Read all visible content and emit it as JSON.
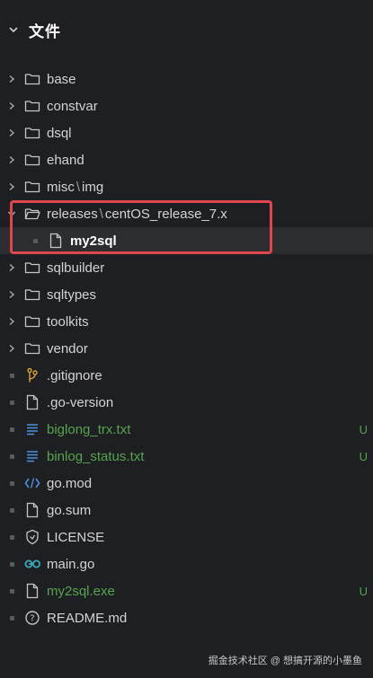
{
  "explorer": {
    "title": "文件",
    "items": [
      {
        "label": "base",
        "type": "folder"
      },
      {
        "label": "constvar",
        "type": "folder"
      },
      {
        "label": "dsql",
        "type": "folder"
      },
      {
        "label": "ehand",
        "type": "folder"
      },
      {
        "label_a": "misc",
        "label_b": "img",
        "type": "folder"
      },
      {
        "label_a": "releases",
        "label_b": "centOS_release_7.x",
        "type": "folder-open"
      },
      {
        "label": "my2sql",
        "type": "file-sub"
      },
      {
        "label": "sqlbuilder",
        "type": "folder"
      },
      {
        "label": "sqltypes",
        "type": "folder"
      },
      {
        "label": "toolkits",
        "type": "folder"
      },
      {
        "label": "vendor",
        "type": "folder"
      },
      {
        "label": ".gitignore",
        "type": "git"
      },
      {
        "label": ".go-version",
        "type": "file"
      },
      {
        "label": "biglong_trx.txt",
        "type": "text",
        "status": "U"
      },
      {
        "label": "binlog_status.txt",
        "type": "text",
        "status": "U"
      },
      {
        "label": "go.mod",
        "type": "gomod"
      },
      {
        "label": "go.sum",
        "type": "file"
      },
      {
        "label": "LICENSE",
        "type": "license"
      },
      {
        "label": "main.go",
        "type": "go"
      },
      {
        "label": "my2sql.exe",
        "type": "file",
        "status": "U"
      },
      {
        "label": "README.md",
        "type": "readme"
      }
    ]
  },
  "watermark": "掘金技术社区 @ 想搞开源的小墨鱼",
  "colors": {
    "background": "#1e1f22",
    "untracked": "#57a44c",
    "highlight_border": "#e0474c",
    "selected_row": "#2c2d31"
  }
}
